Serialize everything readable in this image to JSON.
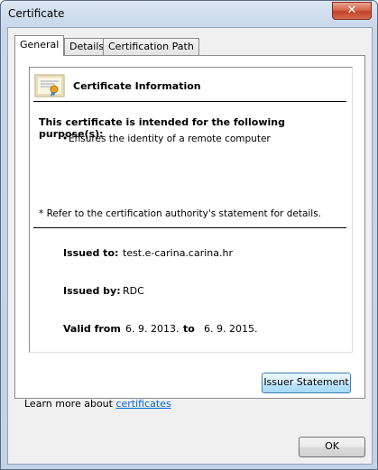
{
  "window": {
    "title": "Certificate",
    "close_glyph": "✕"
  },
  "tabs": [
    {
      "label": "General",
      "active": true
    },
    {
      "label": "Details",
      "active": false
    },
    {
      "label": "Certification Path",
      "active": false
    }
  ],
  "info": {
    "icon": "certificate-icon",
    "title": "Certificate Information",
    "purpose_heading": "This certificate is intended for the following purpose(s):",
    "purposes": [
      "Ensures the identity of a remote computer"
    ],
    "bullet": "•",
    "refer_note": "* Refer to the certification authority's statement for details."
  },
  "fields": {
    "issued_to_label": "Issued to:",
    "issued_to_value": "test.e-carina.carina.hr",
    "issued_by_label": "Issued by:",
    "issued_by_value": "RDC",
    "valid_from_label": "Valid from",
    "valid_from_value": "6. 9. 2013.",
    "to_label": "to",
    "valid_to_value": "6. 9. 2015."
  },
  "buttons": {
    "issuer_statement": "Issuer Statement",
    "ok": "OK"
  },
  "learn_more": {
    "prefix": "Learn more about ",
    "link": "certificates"
  }
}
